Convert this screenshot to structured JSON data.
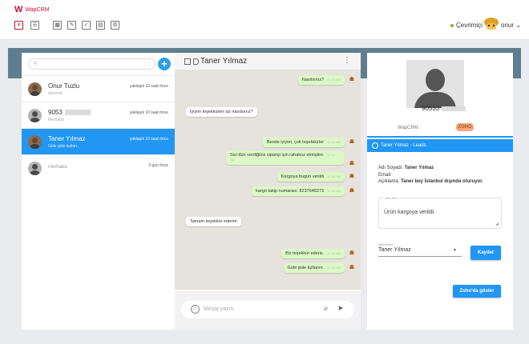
{
  "app": {
    "brand_mark": "W",
    "brand_name": "WapCRM"
  },
  "toolbar": {
    "icons": [
      "chat-icon",
      "list-icon",
      "grid-icon",
      "edit-icon",
      "check-icon",
      "calendar-icon",
      "settings-icon"
    ]
  },
  "status": {
    "label": "Çevrimiçi",
    "color": "#7cb342"
  },
  "user": {
    "name": "onur"
  },
  "search": {
    "placeholder": ""
  },
  "contacts": [
    {
      "name": "Onur Tuzlu",
      "sub": "deneme",
      "time": "yaklaşık 10 saat önce"
    },
    {
      "name": "9053",
      "sub": "Merhaba",
      "time": "yaklaşık 10 saat önce"
    },
    {
      "name": "Taner Yılmaz",
      "sub": "Güle güle kullan..",
      "time": "yaklaşık 10 saat önce"
    },
    {
      "name": "merhaba",
      "sub": "",
      "time": "3 gün önce"
    }
  ],
  "chat": {
    "title": "Taner Yılmaz",
    "menu": "⋮",
    "messages": [
      {
        "dir": "out",
        "text": "Nasılsınız?",
        "time": "10:44 AM"
      },
      {
        "dir": "in",
        "text": "İyiyim teşekkürler siz nasılsınız?",
        "time": ""
      },
      {
        "dir": "out",
        "text": "Bende iyiyim, çok teşekkürler",
        "time": "10:44 AM"
      },
      {
        "dir": "out",
        "text": "Sizi dün verdiğiniz siparişi için rahatsız etmiştim.",
        "time": "10:44 AM"
      },
      {
        "dir": "out",
        "text": "Kargoya bugün verildi",
        "time": "10:44 AM"
      },
      {
        "dir": "out",
        "text": "kargo takip numarası: 8237648273",
        "time": "10:44 AM"
      },
      {
        "dir": "in",
        "text": "Tamam teşekkür ederim",
        "time": ""
      },
      {
        "dir": "out",
        "text": "Biz teşekkür ederiz.",
        "time": "10:44 AM"
      },
      {
        "dir": "out",
        "text": "Güle güle kullanın.",
        "time": "10:44 AM"
      }
    ],
    "compose_placeholder": "Mesaj yazın"
  },
  "profile": {
    "phone": "90533",
    "tab_wapcrm": "WapCRM",
    "tab_zoho": "ZOHO",
    "lead_bar": "Taner Yılmaz - Leads",
    "name_label": "Adı Soyadı:",
    "name_value": "Taner Yılmaz",
    "email_label": "Email:",
    "desc_label": "Açıklama:",
    "desc_value": "Taner bey İstanbul dışında oturuyor.",
    "note_label": "Yeni Not",
    "note_value": "Ürün kargoya verildi.",
    "assignee_label": "İlgili kişiler",
    "assignee_value": "Taner Yılmaz",
    "save_label": "Kaydet",
    "zoho_button": "Zoho'da göster"
  },
  "colors": {
    "accent": "#2196f3",
    "brand": "#c8102e",
    "band": "#5f7d8e",
    "bubble_out": "#dcf8c6"
  }
}
